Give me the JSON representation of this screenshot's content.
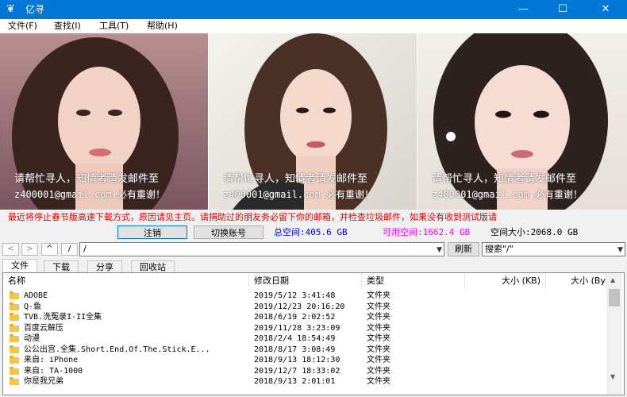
{
  "window": {
    "title": "亿寻",
    "icon": "app-logo-icon",
    "accent": "#0078d7"
  },
  "menu": [
    "文件(F)",
    "查找(I)",
    "工具(T)",
    "帮助(H)"
  ],
  "banner": {
    "captions": [
      {
        "line1": "请帮忙寻人，知情者请发邮件至",
        "line2": "z400001@gmail.com 必有重谢！"
      },
      {
        "line1": "请帮忙寻人，知情者请发邮件至",
        "line2": "z400001@gmail.com 必有重谢！"
      },
      {
        "line1": "请帮忙寻人，知情者请发邮件至",
        "line2": "z400001@gmail.com 必有重谢！"
      }
    ]
  },
  "notice": "最近将停止春节版高速下载方式，原因请见主页。请捐助过的朋友务必留下你的邮箱，并检查垃圾邮件，如果没有收到测试版请",
  "account": {
    "logout_label": "注销",
    "switch_label": "切换账号",
    "total_label": "总空间:405.6 GB",
    "available_label": "可用空间:1662.4 GB",
    "size_label": "空间大小:2068.0 GB",
    "total_color": "#0000ff",
    "available_color": "#ff00ff"
  },
  "nav": {
    "back": "<",
    "forward": ">",
    "up": "^",
    "root": "/",
    "path": "/",
    "refresh_label": "刷新",
    "search_value": "搜索\"/\""
  },
  "tabs": [
    "文件",
    "下载",
    "分享",
    "回收站"
  ],
  "columns": [
    "名称",
    "修改日期",
    "类型",
    "大小 (KB)",
    "大小 (By"
  ],
  "files": [
    {
      "name": "ADOBE",
      "date": "2019/5/12 3:41:48",
      "type": "文件夹"
    },
    {
      "name": "Q-鱼",
      "date": "2019/12/23 20:16:20",
      "type": "文件夹"
    },
    {
      "name": "TVB.洗冤录I-II全集",
      "date": "2018/6/19 2:02:52",
      "type": "文件夹"
    },
    {
      "name": "百度云解压",
      "date": "2019/11/28 3:23:09",
      "type": "文件夹"
    },
    {
      "name": "动漫",
      "date": "2018/2/4 18:54:49",
      "type": "文件夹"
    },
    {
      "name": "公公出宫.全集.Short.End.Of.The.Stick.E...",
      "date": "2018/8/17 3:08:49",
      "type": "文件夹"
    },
    {
      "name": "来自: iPhone",
      "date": "2018/9/13 18:12:30",
      "type": "文件夹"
    },
    {
      "name": "来自: TA-1000",
      "date": "2019/12/7 18:33:02",
      "type": "文件夹"
    },
    {
      "name": "你是我兄弟",
      "date": "2018/9/13 2:01:01",
      "type": "文件夹"
    }
  ]
}
